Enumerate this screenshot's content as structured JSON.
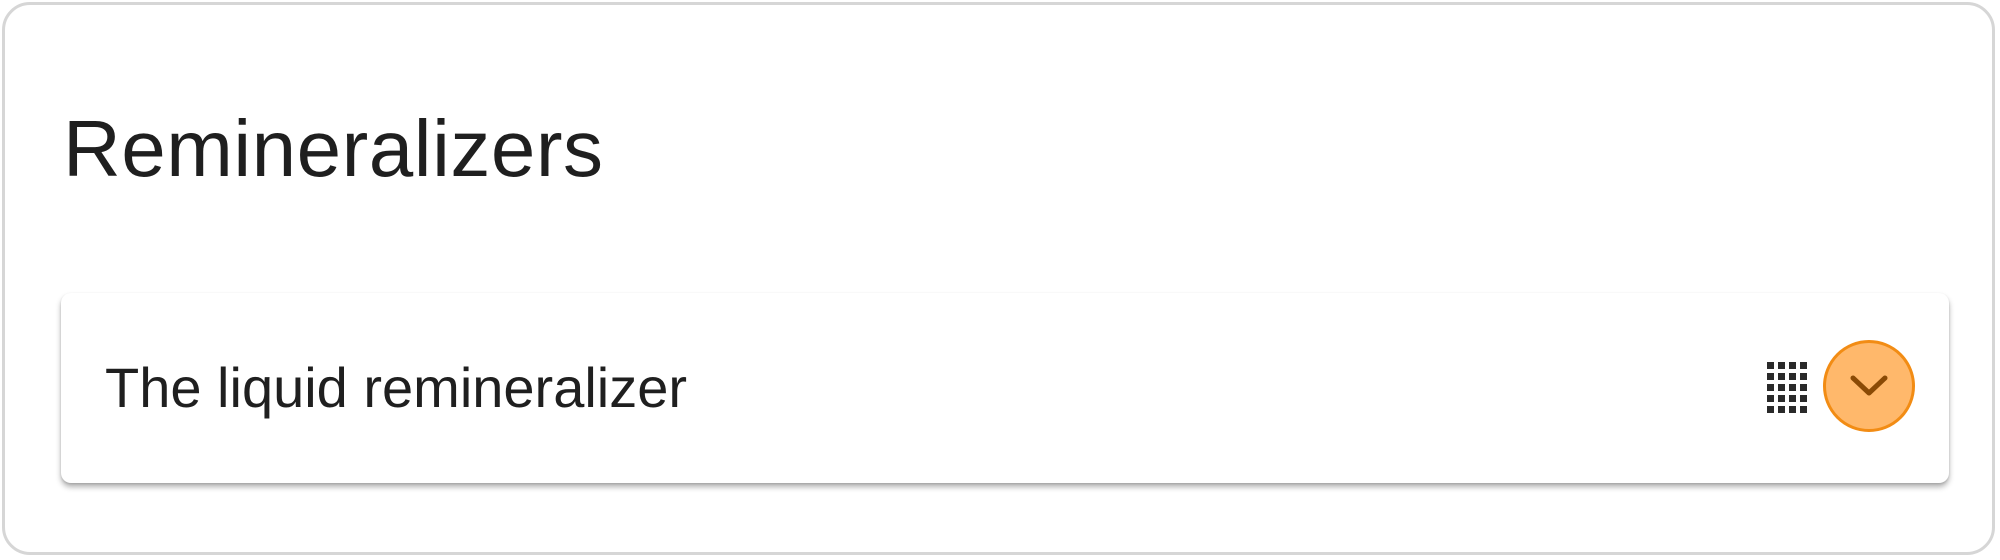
{
  "section": {
    "title": "Remineralizers"
  },
  "items": [
    {
      "label": "The liquid remineralizer",
      "drag_icon": "drag-handle-grid-icon",
      "expand_icon": "chevron-down-icon"
    }
  ],
  "colors": {
    "expand_fill": "#ffb86b",
    "expand_border": "#f28c14",
    "chevron": "#8a4a05",
    "text": "#1f1f1f",
    "panel_border": "#d6d6d6"
  }
}
